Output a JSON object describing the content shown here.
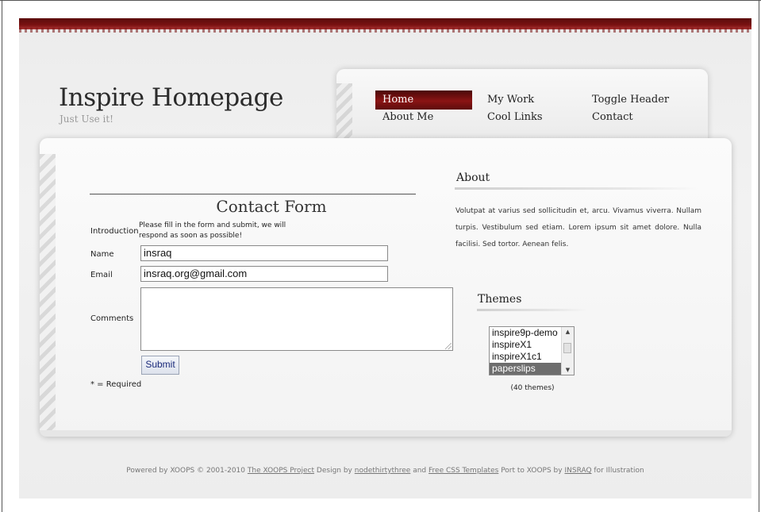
{
  "header": {
    "title": "Inspire Homepage",
    "slogan": "Just Use it!"
  },
  "nav": {
    "items": [
      {
        "label": "Home",
        "active": true
      },
      {
        "label": "My Work"
      },
      {
        "label": "Toggle Header"
      },
      {
        "label": "About Me"
      },
      {
        "label": "Cool Links"
      },
      {
        "label": "Contact"
      }
    ]
  },
  "contact_form": {
    "title": "Contact Form",
    "introduction_label": "Introduction",
    "introduction_text": "Please fill in the form and submit, we will respond as soon as possible!",
    "name_label": "Name",
    "name_value": "insraq",
    "email_label": "Email",
    "email_value": "insraq.org@gmail.com",
    "comments_label": "Comments",
    "comments_value": "",
    "submit_label": "Submit",
    "required_note": "* = Required"
  },
  "about": {
    "title": "About",
    "text": "Volutpat at varius sed sollicitudin et, arcu. Vivamus viverra. Nullam turpis. Vestibulum sed etiam. Lorem ipsum sit amet dolore. Nulla facilisi. Sed tortor. Aenean felis."
  },
  "themes": {
    "title": "Themes",
    "options": [
      "inspire9p-demo",
      "inspireX1",
      "inspireX1c1",
      "paperslips"
    ],
    "selected": "paperslips",
    "count_text": "(40 themes)"
  },
  "footer": {
    "prefix": "Powered by XOOPS © 2001-2010",
    "xoops_link": "The XOOPS Project",
    "design_by": "Design by",
    "designer_link": "nodethirtythree",
    "and": "and",
    "templates_link": "Free CSS Templates",
    "port_text": "Port to XOOPS by",
    "porter_link": "INSRAQ",
    "suffix": "for Illustration"
  },
  "colors": {
    "accent": "#7a1212",
    "background": "#ececec"
  }
}
